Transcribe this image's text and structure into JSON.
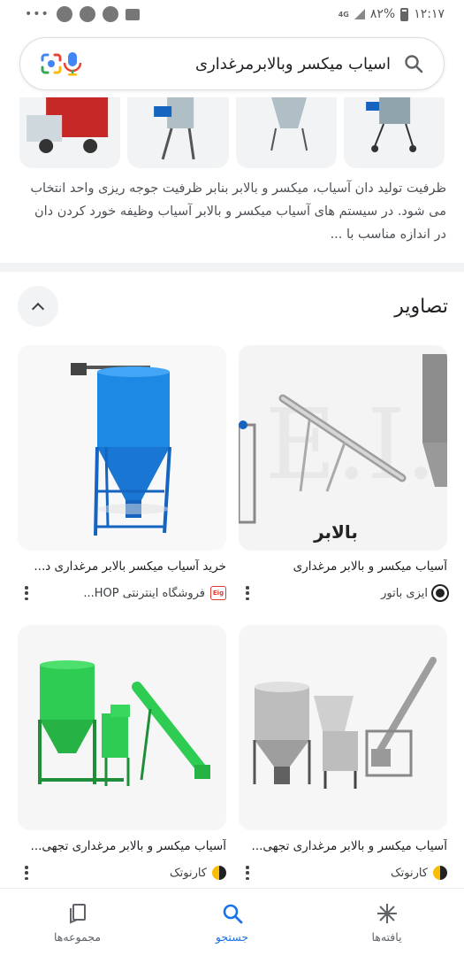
{
  "status_bar": {
    "time": "۱۲:۱۷",
    "battery": "۸۲%",
    "network": "4G"
  },
  "search": {
    "query": "اسیاب میکسر وبالابرمرغداری",
    "icons": [
      "search-icon",
      "mic-icon",
      "lens-icon"
    ]
  },
  "snippet": {
    "text": "ظرفیت تولید دان آسیاب، میکسر و بالابر بنابر ظرفیت جوجه ریزی واحد انتخاب می شود. در سیستم های آسیاب میکسر و بالابر آسیاب وظیفه خورد کردن دان در اندازه مناسب با ..."
  },
  "images_section": {
    "title": "تصاویر",
    "results": [
      {
        "title": "آسیاب میکسر و بالابر مرغداری",
        "source": "ایزی باتور",
        "overlay_text": "بالابر",
        "favicon_color": "#222222"
      },
      {
        "title": "خرید آسیاب میکسر بالابر مرغداری د...",
        "source": "فروشگاه اینترنتی HOP...",
        "favicon_text": "Eig",
        "favicon_color": "#e53935"
      },
      {
        "title": "آسیاب میکسر و بالابر مرغداری تجهی...",
        "source": "کارنوتک",
        "favicon_color": "#fbbc04"
      },
      {
        "title": "آسیاب میکسر و بالابر مرغداری تجهی...",
        "source": "کارنوتک",
        "favicon_color": "#fbbc04"
      }
    ]
  },
  "bottom_nav": {
    "items": [
      {
        "label": "یافته‌ها",
        "icon": "asterisk-icon"
      },
      {
        "label": "جستجو",
        "icon": "search-icon",
        "active": true
      },
      {
        "label": "مجموعه‌ها",
        "icon": "collections-icon"
      }
    ]
  },
  "colors": {
    "accent": "#1a73e8",
    "mixer_blue": "#1e88e5",
    "mixer_green": "#2ecc52"
  }
}
